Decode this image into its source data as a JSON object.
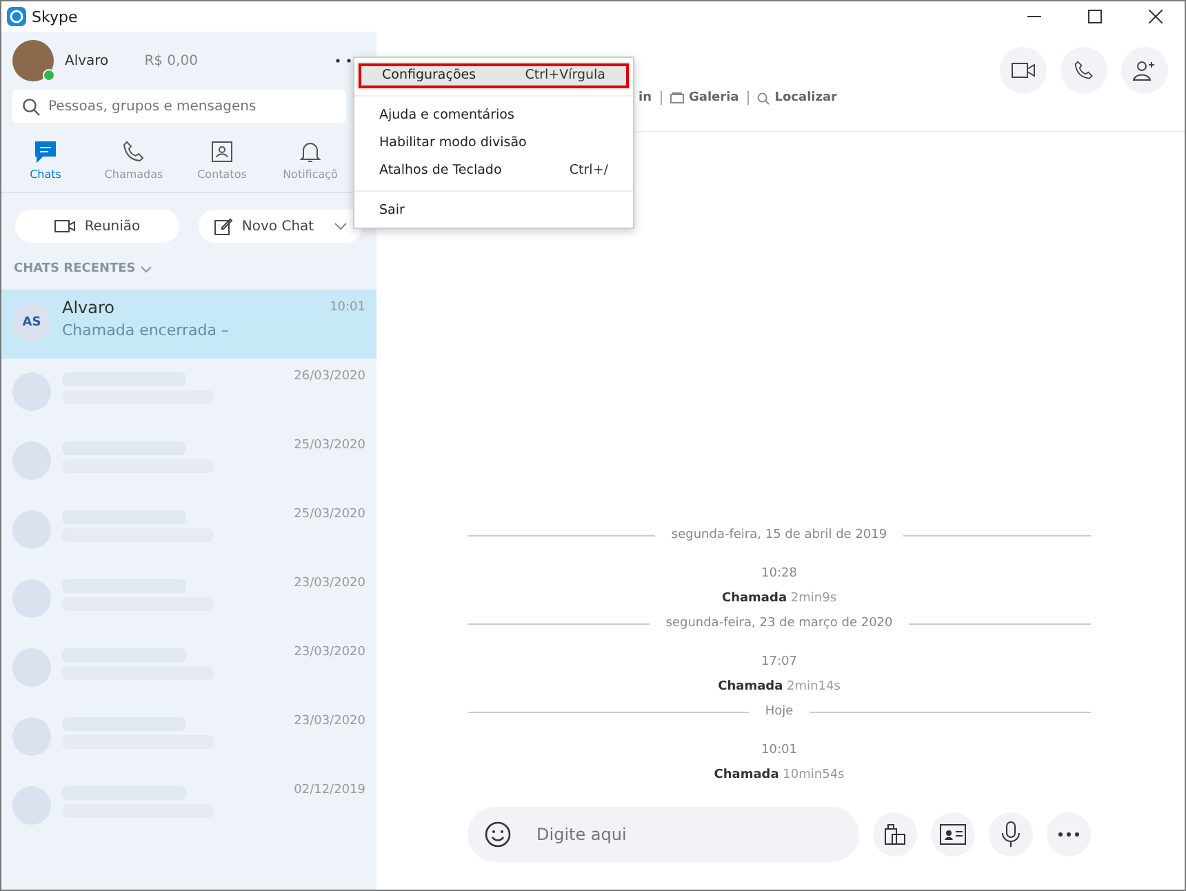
{
  "window": {
    "title": "Skype"
  },
  "profile": {
    "name": "Alvaro",
    "credit": "R$ 0,00",
    "online": true
  },
  "search": {
    "placeholder": "Pessoas, grupos e mensagens"
  },
  "nav_tabs": [
    {
      "label": "Chats",
      "kind": "chat",
      "selected": true
    },
    {
      "label": "Chamadas",
      "kind": "call",
      "selected": false
    },
    {
      "label": "Contatos",
      "kind": "contacts",
      "selected": false
    },
    {
      "label": "Notificaçõ",
      "kind": "bell",
      "selected": false
    }
  ],
  "actions": [
    {
      "label": "Reunião",
      "kind": "meeting"
    },
    {
      "label": "Novo Chat",
      "kind": "new"
    }
  ],
  "recent_header": "CHATS RECENTES",
  "chats": [
    {
      "name": "Alvaro",
      "initials": "AS",
      "preview": "Chamada encerrada –",
      "time": "10:01",
      "selected": true
    },
    {
      "time": "26/03/2020",
      "selected": false
    },
    {
      "time": "25/03/2020",
      "selected": false
    },
    {
      "time": "25/03/2020",
      "selected": false
    },
    {
      "time": "23/03/2020",
      "selected": false
    },
    {
      "time": "23/03/2020",
      "selected": false
    },
    {
      "time": "23/03/2020",
      "selected": false
    },
    {
      "time": "02/12/2019",
      "selected": false
    }
  ],
  "menu": [
    {
      "label": "Configurações",
      "shortcut": "Ctrl+Vírgula",
      "highlighted": true
    },
    {
      "label": "Ajuda e comentários",
      "highlighted": false
    },
    {
      "label": "Habilitar modo divisão",
      "highlighted": false
    },
    {
      "label": "Atalhos de Teclado",
      "shortcut": "Ctrl+/",
      "highlighted": false
    },
    {
      "label": "Sair",
      "highlighted": false,
      "separator_before": true
    }
  ],
  "header_links": [
    {
      "label": "in"
    },
    {
      "label": "Galeria",
      "kind": "gallery"
    },
    {
      "label": "Localizar",
      "kind": "search"
    }
  ],
  "conversation": [
    {
      "kind": "day",
      "text": "segunda-feira, 15 de abril de 2019"
    },
    {
      "kind": "call",
      "time": "10:28",
      "label": "Chamada",
      "duration": "2min9s"
    },
    {
      "kind": "day",
      "text": "segunda-feira, 23 de março de 2020"
    },
    {
      "kind": "call",
      "time": "17:07",
      "label": "Chamada",
      "duration": "2min14s"
    },
    {
      "kind": "day",
      "text": "Hoje"
    },
    {
      "kind": "call",
      "time": "10:01",
      "label": "Chamada",
      "duration": "10min54s"
    }
  ],
  "composer": {
    "placeholder": "Digite aqui"
  }
}
